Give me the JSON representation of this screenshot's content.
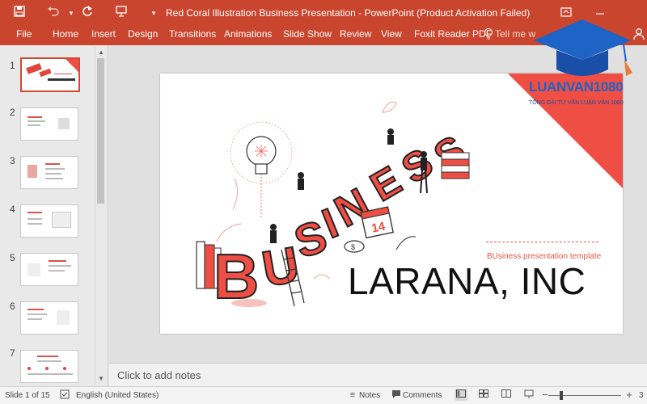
{
  "window": {
    "title": "Red Coral Illustration Business Presentation - PowerPoint (Product Activation Failed)"
  },
  "ribbon": {
    "tabs": [
      "File",
      "Home",
      "Insert",
      "Design",
      "Transitions",
      "Animations",
      "Slide Show",
      "Review",
      "View",
      "Foxit Reader PDF"
    ],
    "tell_me": "Tell me w"
  },
  "thumbnails": [
    {
      "number": "1",
      "selected": true
    },
    {
      "number": "2"
    },
    {
      "number": "3"
    },
    {
      "number": "4"
    },
    {
      "number": "5"
    },
    {
      "number": "6"
    },
    {
      "number": "7"
    }
  ],
  "slide": {
    "subtitle": "BUsiness presentation template",
    "title": "LARANA, INC",
    "illustration_word": "BUSINESS",
    "calendar_number": "14",
    "accent_color": "#ef4e44"
  },
  "notes": {
    "placeholder": "Click to add notes"
  },
  "statusbar": {
    "slide_info": "Slide 1 of 15",
    "language": "English (United States)",
    "notes_label": "Notes",
    "comments_label": "Comments",
    "zoom_value": "3"
  },
  "watermark": {
    "brand": "LUANVAN1080",
    "tagline": "TỔNG ĐÀI TƯ VẤN LUẬN VĂN 1080"
  },
  "colors": {
    "titlebar": "#c9452e",
    "accent": "#ef4e44"
  }
}
